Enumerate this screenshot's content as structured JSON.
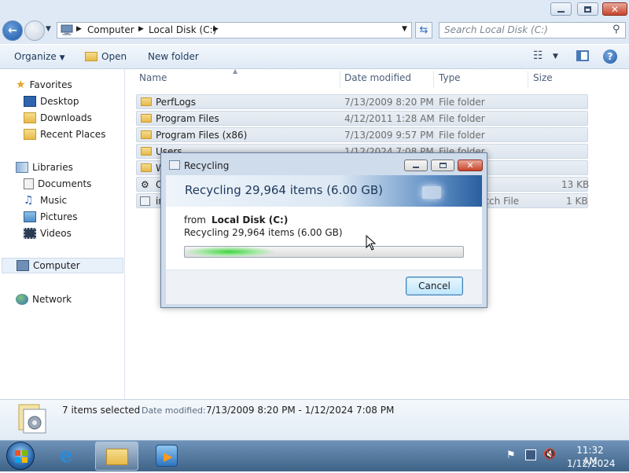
{
  "window": {
    "address_segments": [
      "Computer",
      "Local Disk (C:)"
    ],
    "search_placeholder": "Search Local Disk (C:)"
  },
  "toolbar": {
    "organize_label": "Organize",
    "open_label": "Open",
    "new_folder_label": "New folder"
  },
  "nav": {
    "favorites": "Favorites",
    "favorites_items": [
      "Desktop",
      "Downloads",
      "Recent Places"
    ],
    "libraries": "Libraries",
    "libraries_items": [
      "Documents",
      "Music",
      "Pictures",
      "Videos"
    ],
    "computer": "Computer",
    "network": "Network"
  },
  "columns": {
    "name": "Name",
    "date_modified": "Date modified",
    "type": "Type",
    "size": "Size"
  },
  "files": [
    {
      "name": "PerfLogs",
      "date": "7/13/2009 8:20 PM",
      "type": "File folder",
      "size": ""
    },
    {
      "name": "Program Files",
      "date": "4/12/2011 1:28 AM",
      "type": "File folder",
      "size": ""
    },
    {
      "name": "Program Files (x86)",
      "date": "7/13/2009 9:57 PM",
      "type": "File folder",
      "size": ""
    },
    {
      "name": "Users",
      "date": "1/12/2024 7:08 PM",
      "type": "File folder",
      "size": ""
    },
    {
      "name": "W",
      "date": "",
      "type": "",
      "size": ""
    },
    {
      "name": "C",
      "date": "",
      "type": "",
      "size": "13 KB"
    },
    {
      "name": "in",
      "date": "",
      "type": "atch File",
      "size": "1 KB"
    }
  ],
  "details_pane": {
    "selection_count": "7 items selected",
    "date_label": "Date modified:",
    "date_range": "7/13/2009 8:20 PM - 1/12/2024 7:08 PM"
  },
  "dialog": {
    "title": "Recycling",
    "banner_text": "Recycling 29,964 items (6.00 GB)",
    "from_prefix": "from",
    "from_location": "Local Disk (C:)",
    "status_text": "Recycling 29,964 items (6.00 GB)",
    "progress_fraction": 0.32,
    "cancel_label": "Cancel"
  },
  "taskbar": {
    "time": "11:32 AM",
    "date": "1/12/2024"
  },
  "colors": {
    "accent": "#1d57a8",
    "progress_green": "#3fd33f"
  }
}
